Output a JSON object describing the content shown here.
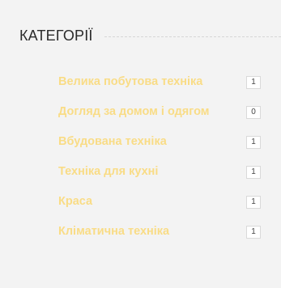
{
  "widget": {
    "title": "КАТЕГОРІЇ"
  },
  "categories": [
    {
      "label": "Велика побутова техніка",
      "count": "1"
    },
    {
      "label": "Догляд за домом і одягом",
      "count": "0"
    },
    {
      "label": "Вбудована техніка",
      "count": "1"
    },
    {
      "label": "Техніка для кухні",
      "count": "1"
    },
    {
      "label": "Краса",
      "count": "1"
    },
    {
      "label": "Кліматична техніка",
      "count": "1"
    }
  ],
  "colors": {
    "background": "#f3f3f3",
    "title": "#2b2b2b",
    "link": "#f9dc86",
    "badge_bg": "#ffffff",
    "badge_border": "#d9d9d9"
  }
}
